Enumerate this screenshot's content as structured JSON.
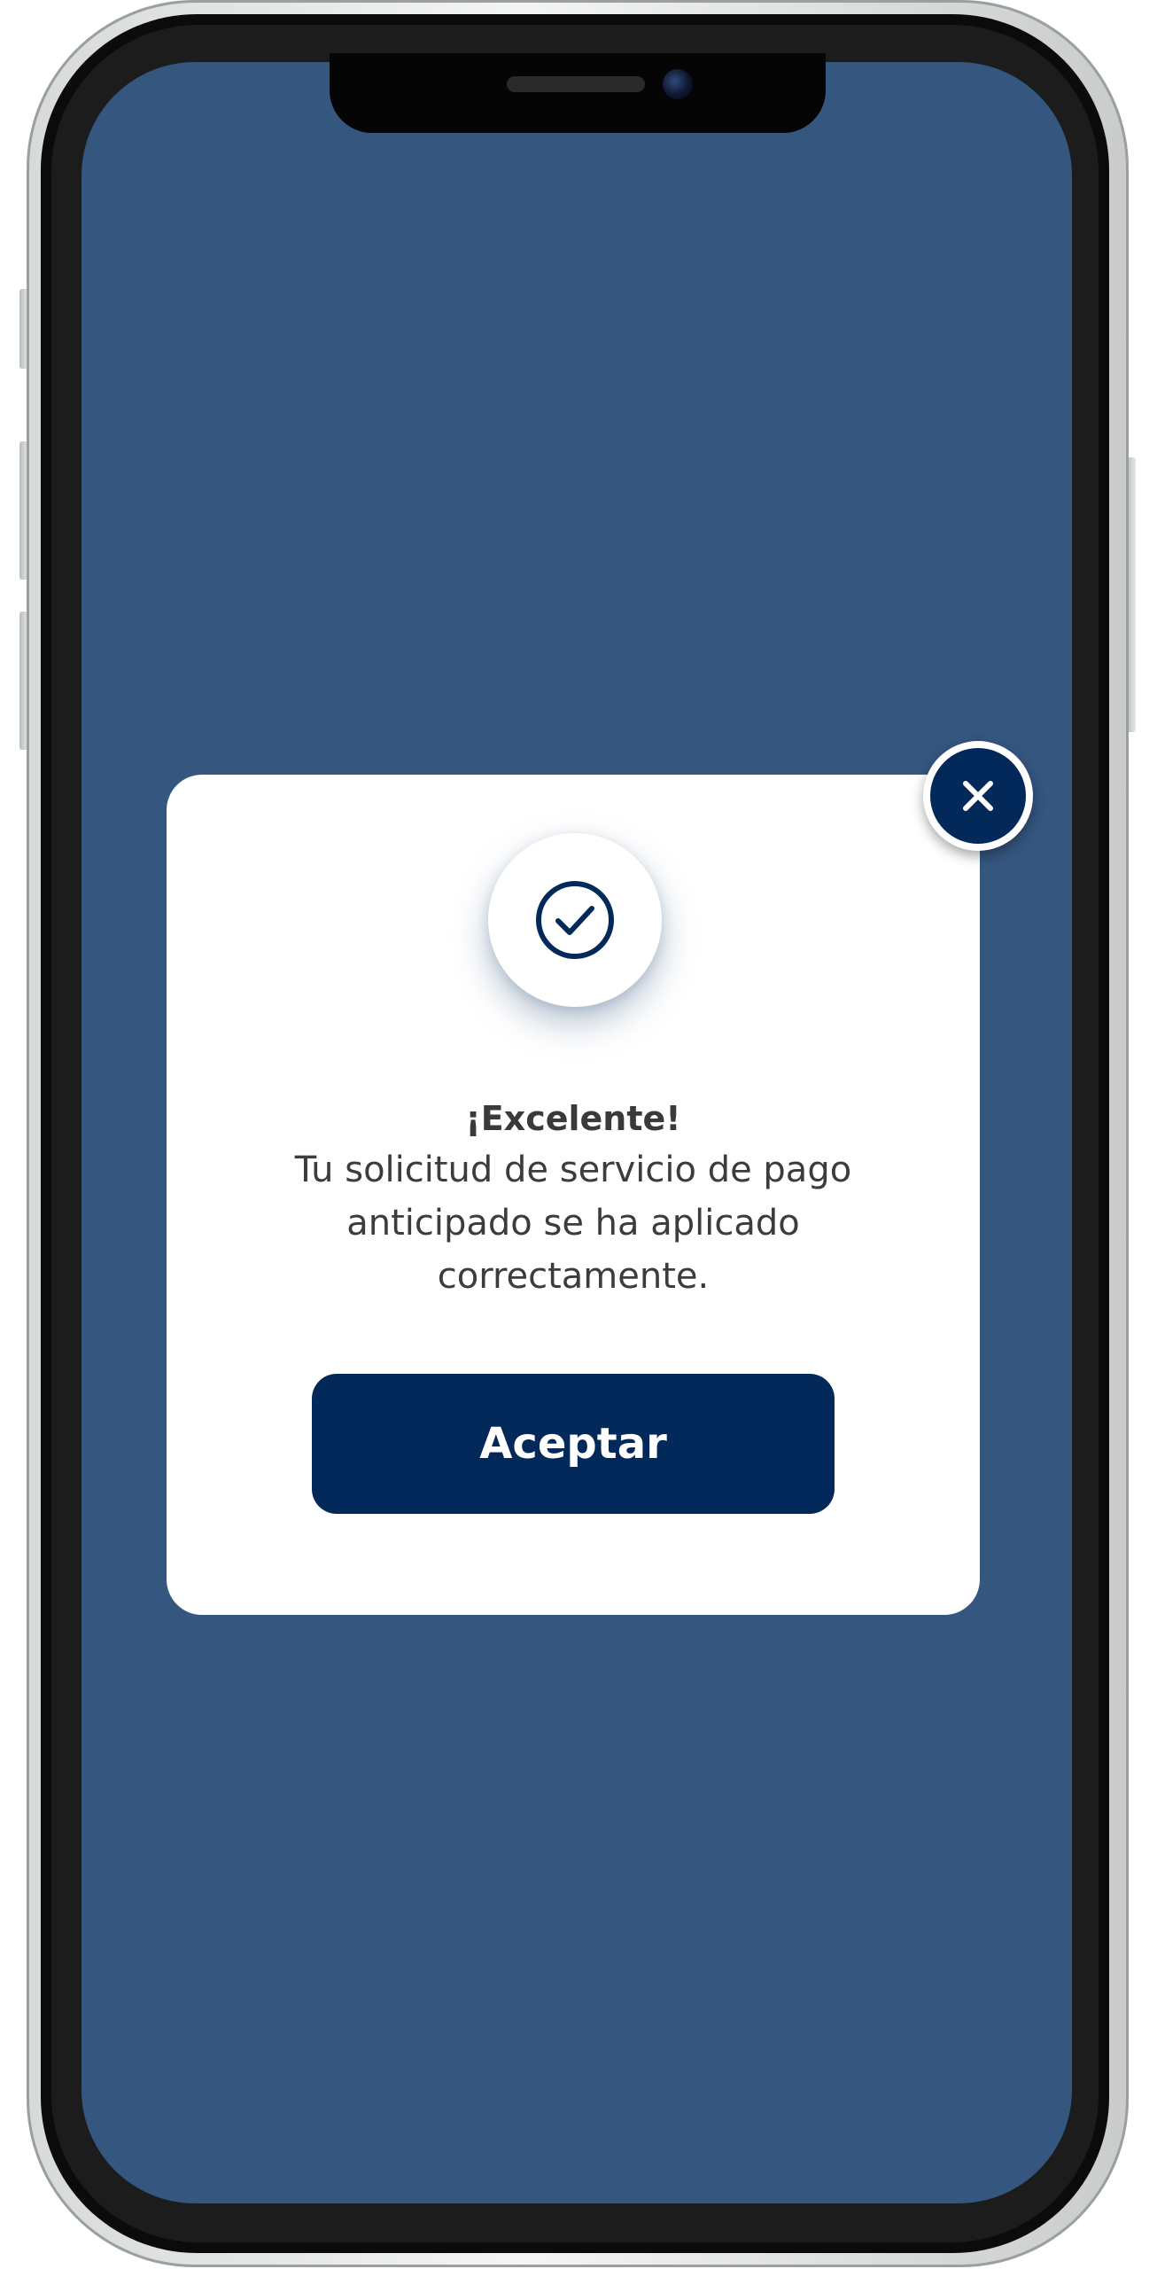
{
  "screen": {
    "background_color": "#35567f"
  },
  "dialog": {
    "status_icon": "check-circle-icon",
    "close_icon": "close-icon",
    "title": "¡Excelente!",
    "message": "Tu solicitud de servicio de pago anticipado se ha aplicado correctamente.",
    "accept_label": "Aceptar",
    "accent_color": "#03295a"
  }
}
